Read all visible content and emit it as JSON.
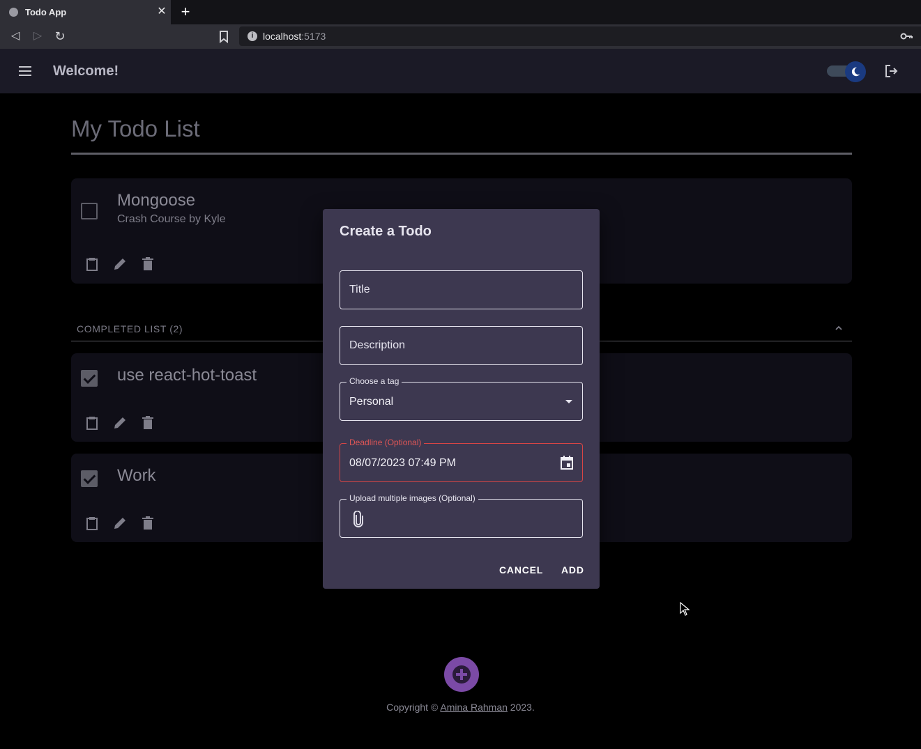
{
  "browser": {
    "tab_title": "Todo App",
    "tab_close": "✕",
    "new_tab": "+",
    "url_host": "localhost",
    "url_port": ":5173",
    "back": "◁",
    "forward": "▷",
    "reload": "↻"
  },
  "appbar": {
    "welcome": "Welcome!",
    "theme_toggle_state": "dark"
  },
  "page": {
    "title": "My Todo List"
  },
  "todos": [
    {
      "title": "Mongoose",
      "description": "Crash Course by Kyle",
      "completed": false
    }
  ],
  "completed": {
    "label": "COMPLETED LIST (2)",
    "items": [
      {
        "title": "use react-hot-toast",
        "completed": true
      },
      {
        "title": "Work",
        "completed": true
      }
    ]
  },
  "dialog": {
    "title": "Create a Todo",
    "title_placeholder": "Title",
    "description_placeholder": "Description",
    "tag_label": "Choose a tag",
    "tag_value": "Personal",
    "deadline_label": "Deadline (Optional)",
    "deadline_value": "08/07/2023 07:49 PM",
    "upload_label": "Upload multiple images (Optional)",
    "cancel_label": "CANCEL",
    "add_label": "ADD"
  },
  "footer": {
    "prefix": "Copyright © ",
    "author": "Amina Rahman",
    "suffix": " 2023."
  },
  "colors": {
    "appbar_bg": "#1b1a26",
    "dialog_bg": "#3d3850",
    "fab": "#7b4aa6",
    "error": "#d64545"
  }
}
